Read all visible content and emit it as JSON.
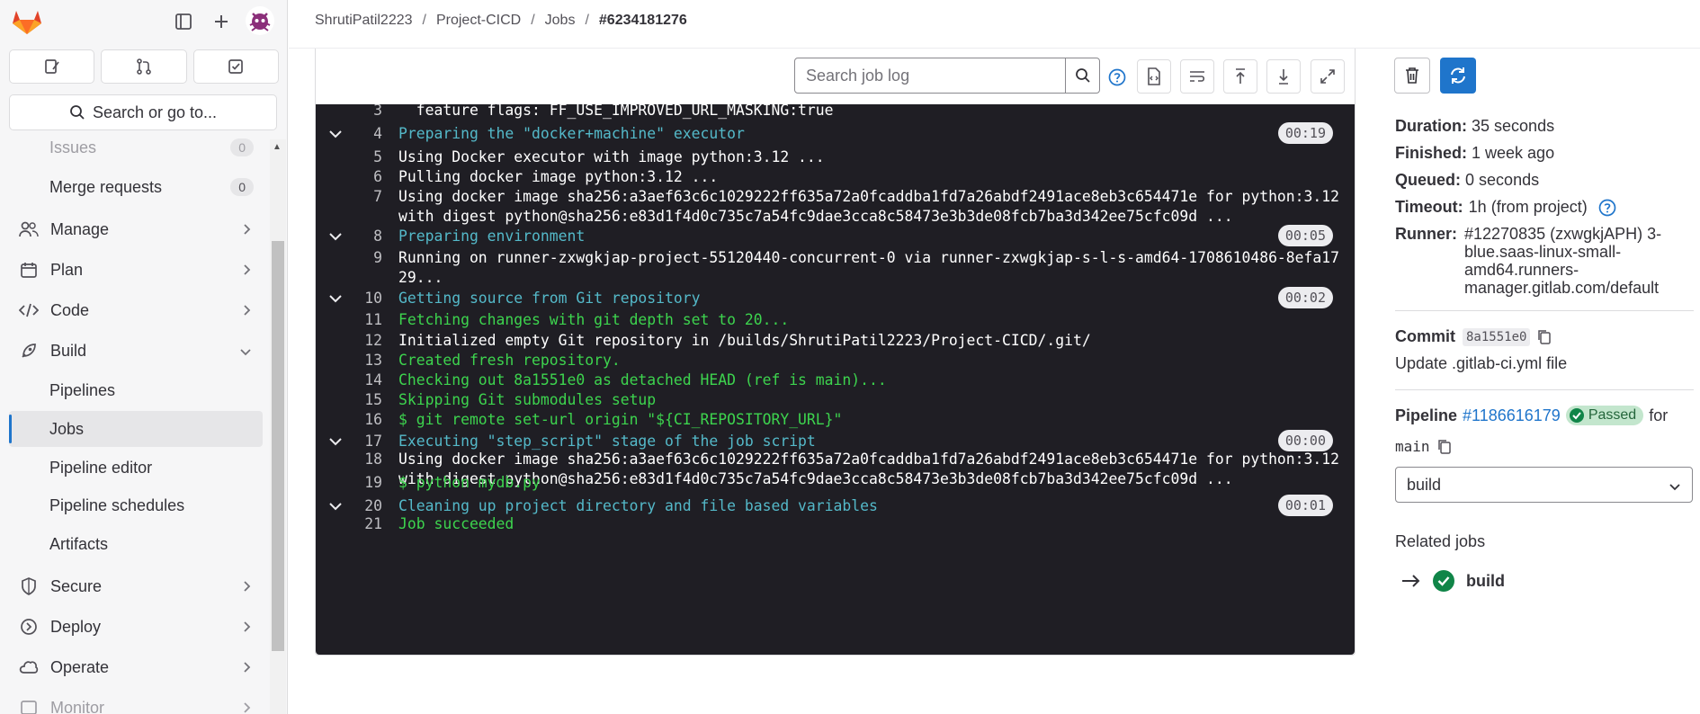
{
  "breadcrumb": {
    "user": "ShrutiPatil2223",
    "project": "Project-CICD",
    "section": "Jobs",
    "job": "#6234181276",
    "sep": "/"
  },
  "sidebar": {
    "search_label": "Search or go to...",
    "issues": {
      "label": "Issues",
      "count": "0"
    },
    "merge_requests": {
      "label": "Merge requests",
      "count": "0"
    },
    "sections": {
      "manage": "Manage",
      "plan": "Plan",
      "code": "Code",
      "build": "Build",
      "secure": "Secure",
      "deploy": "Deploy",
      "operate": "Operate",
      "monitor": "Monitor"
    },
    "build_items": {
      "pipelines": "Pipelines",
      "jobs": "Jobs",
      "pipeline_editor": "Pipeline editor",
      "pipeline_schedules": "Pipeline schedules",
      "artifacts": "Artifacts"
    }
  },
  "log": {
    "search_placeholder": "Search job log",
    "lines": [
      {
        "n": "3",
        "text": "  feature flags: FF_USE_IMPROVED_URL_MASKING:true",
        "color": "white"
      },
      {
        "n": "4",
        "text": "Preparing the \"docker+machine\" executor",
        "color": "cyan",
        "section": true,
        "dur": "00:19"
      },
      {
        "n": "5",
        "text": "Using Docker executor with image python:3.12 ...",
        "color": "white"
      },
      {
        "n": "6",
        "text": "Pulling docker image python:3.12 ...",
        "color": "white"
      },
      {
        "n": "7",
        "text": "Using docker image sha256:a3aef63c6c1029222ff635a72a0fcaddba1fd7a26abdf2491ace8eb3c654471e for python:3.12",
        "text2": "with digest python@sha256:e83d1f4d0c735c7a54fc9dae3cca8c58473e3b3de08fcb7ba3d342ee75cfc09d ...",
        "color": "white"
      },
      {
        "n": "8",
        "text": "Preparing environment",
        "color": "cyan",
        "section": true,
        "dur": "00:05"
      },
      {
        "n": "9",
        "text": "Running on runner-zxwgkjap-project-55120440-concurrent-0 via runner-zxwgkjap-s-l-s-amd64-1708610486-8efa17",
        "text2": "29...",
        "color": "white"
      },
      {
        "n": "10",
        "text": "Getting source from Git repository",
        "color": "cyan",
        "section": true,
        "dur": "00:02"
      },
      {
        "n": "11",
        "text": "Fetching changes with git depth set to 20...",
        "color": "green"
      },
      {
        "n": "12",
        "text": "Initialized empty Git repository in /builds/ShrutiPatil2223/Project-CICD/.git/",
        "color": "white"
      },
      {
        "n": "13",
        "text": "Created fresh repository.",
        "color": "green"
      },
      {
        "n": "14",
        "text": "Checking out 8a1551e0 as detached HEAD (ref is main)...",
        "color": "green"
      },
      {
        "n": "15",
        "text": "Skipping Git submodules setup",
        "color": "green"
      },
      {
        "n": "16",
        "text": "$ git remote set-url origin \"${CI_REPOSITORY_URL}\"",
        "color": "green"
      },
      {
        "n": "17",
        "text": "Executing \"step_script\" stage of the job script",
        "color": "cyan",
        "section": true,
        "dur": "00:00"
      },
      {
        "n": "18",
        "text": "Using docker image sha256:a3aef63c6c1029222ff635a72a0fcaddba1fd7a26abdf2491ace8eb3c654471e for python:3.12",
        "text2": "with digest python@sha256:e83d1f4d0c735c7a54fc9dae3cca8c58473e3b3de08fcb7ba3d342ee75cfc09d ...",
        "color": "white"
      },
      {
        "n": "19",
        "text": "$ python mydb.py",
        "color": "green"
      },
      {
        "n": "20",
        "text": "Cleaning up project directory and file based variables",
        "color": "cyan",
        "section": true,
        "dur": "00:01"
      },
      {
        "n": "21",
        "text": "Job succeeded",
        "color": "green"
      }
    ]
  },
  "job_info": {
    "duration_label": "Duration:",
    "duration": "35 seconds",
    "finished_label": "Finished:",
    "finished": "1 week ago",
    "queued_label": "Queued:",
    "queued": "0 seconds",
    "timeout_label": "Timeout:",
    "timeout": "1h (from project)",
    "runner_label": "Runner:",
    "runner": "#12270835 (zxwgkjAPH) 3-blue.saas-linux-small-amd64.runners-manager.gitlab.com/default",
    "commit_label": "Commit",
    "commit_sha": "8a1551e0",
    "commit_message": "Update .gitlab-ci.yml file",
    "pipeline_label": "Pipeline",
    "pipeline_id": "#1186616179",
    "pipeline_status": "Passed",
    "pipeline_for": "for",
    "branch": "main",
    "stage_select": "build",
    "related_jobs_label": "Related jobs",
    "related_job": "build"
  },
  "colors": {
    "accent": "#1f75cb",
    "success": "#108548",
    "log_bg": "#1f1e24",
    "log_cyan": "#54b9c9",
    "log_green": "#3dd44e"
  }
}
